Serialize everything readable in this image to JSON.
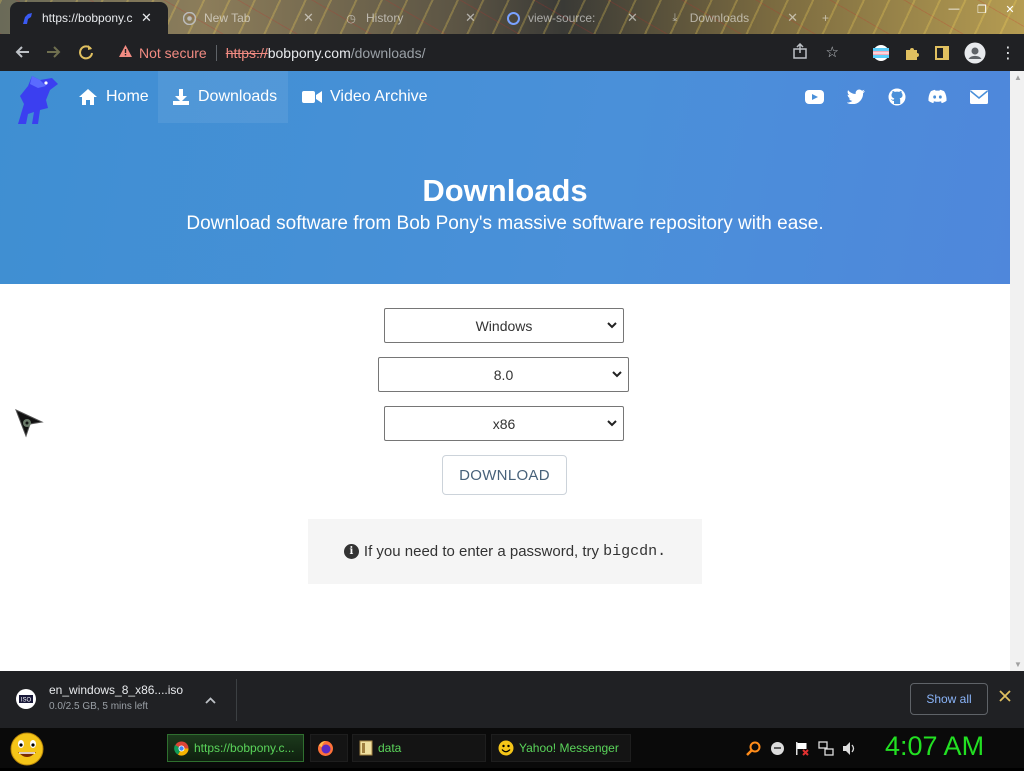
{
  "browser": {
    "tabs": [
      {
        "label": "https://bobpony.c",
        "active": true
      },
      {
        "label": "New Tab",
        "active": false
      },
      {
        "label": "History",
        "active": false
      },
      {
        "label": "view-source:",
        "active": false
      },
      {
        "label": "Downloads",
        "active": false
      }
    ],
    "security_label": "Not secure",
    "url_scheme": "https://",
    "url_host": "bobpony.com",
    "url_path": "/downloads/"
  },
  "site": {
    "nav": [
      {
        "label": "Home",
        "icon": "home-icon"
      },
      {
        "label": "Downloads",
        "icon": "download-icon"
      },
      {
        "label": "Video Archive",
        "icon": "video-camera-icon"
      }
    ],
    "social_icons": [
      "youtube-icon",
      "twitter-icon",
      "github-icon",
      "discord-icon",
      "mail-icon"
    ],
    "hero": {
      "title": "Downloads",
      "subtitle": "Download software from Bob Pony's massive software repository with ease."
    },
    "selects": {
      "os": "Windows",
      "version": "8.0",
      "arch": "x86"
    },
    "download_button": "DOWNLOAD",
    "note": {
      "text": "If you need to enter a password, try",
      "password": "bigcdn."
    },
    "colors": {
      "hero": "#4a90d9",
      "button_text": "#48627a"
    }
  },
  "download_shelf": {
    "filename": "en_windows_8_x86....iso",
    "status": "0.0/2.5 GB, 5 mins left",
    "file_icon_label": "ISO",
    "show_all": "Show all"
  },
  "taskbar": {
    "buttons": [
      {
        "label": "https://bobpony.c...",
        "icon": "chrome-icon"
      },
      {
        "label": "",
        "icon": "firefox-icon"
      },
      {
        "label": "data",
        "icon": "folder-icon"
      },
      {
        "label": "Yahoo! Messenger",
        "icon": "yahoo-messenger-icon"
      }
    ],
    "clock": "4:07 AM"
  }
}
